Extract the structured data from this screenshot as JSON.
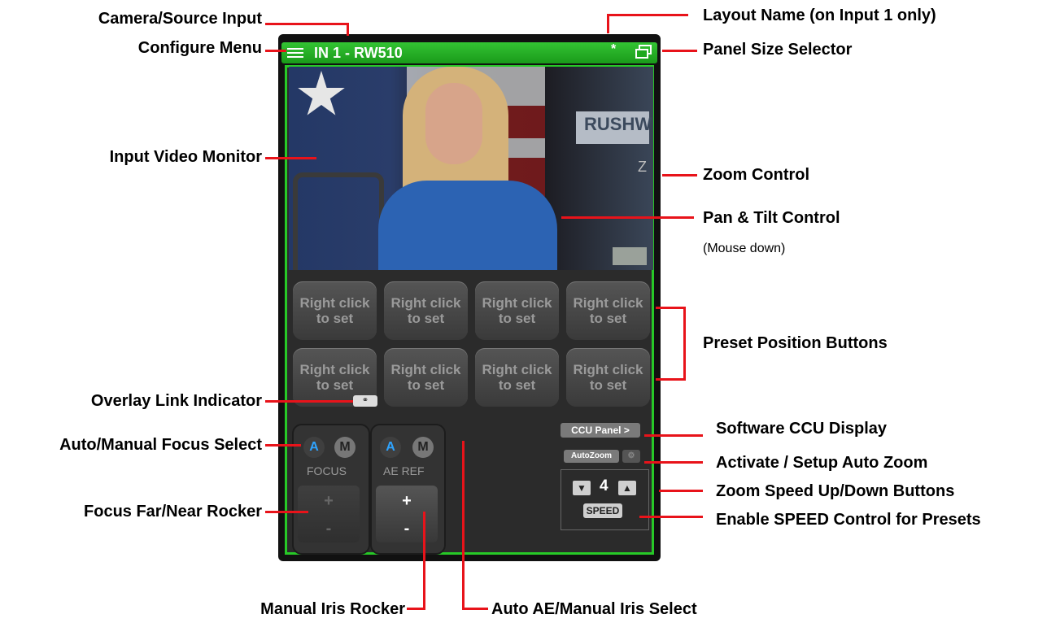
{
  "panel": {
    "title": "IN 1 - RW510",
    "layout_marker": "*",
    "zoom_hint": "Z",
    "presets": [
      {
        "line1": "Right click",
        "line2": "to set"
      },
      {
        "line1": "Right click",
        "line2": "to set"
      },
      {
        "line1": "Right click",
        "line2": "to set"
      },
      {
        "line1": "Right click",
        "line2": "to set"
      },
      {
        "line1": "Right click",
        "line2": "to set"
      },
      {
        "line1": "Right click",
        "line2": "to set"
      },
      {
        "line1": "Right click",
        "line2": "to set"
      },
      {
        "line1": "Right click",
        "line2": "to set"
      }
    ],
    "focus": {
      "auto": "A",
      "manual": "M",
      "label": "FOCUS",
      "plus": "+",
      "minus": "-"
    },
    "aeref": {
      "auto": "A",
      "manual": "M",
      "label": "AE REF",
      "plus": "+",
      "minus": "-"
    },
    "ccu_panel": "CCU Panel >",
    "autozoom": "AutoZoom",
    "speed_value": "4",
    "speed_label": "SPEED",
    "video_sign": "RUSHW"
  },
  "callouts": {
    "camera_source_input": "Camera/Source Input",
    "configure_menu": "Configure Menu",
    "input_video_monitor": "Input Video Monitor",
    "overlay_link_indicator": "Overlay Link Indicator",
    "auto_manual_focus_select": "Auto/Manual Focus Select",
    "focus_far_near_rocker": "Focus Far/Near Rocker",
    "manual_iris_rocker": "Manual Iris Rocker",
    "auto_ae_manual_iris_select": "Auto AE/Manual Iris Select",
    "layout_name": "Layout Name (on Input 1 only)",
    "panel_size_selector": "Panel Size Selector",
    "zoom_control": "Zoom Control",
    "pan_tilt_control": "Pan & Tilt Control",
    "pan_tilt_note": "(Mouse down)",
    "preset_position_buttons": "Preset Position Buttons",
    "software_ccu_display": "Software CCU Display",
    "activate_setup_auto_zoom": "Activate / Setup Auto Zoom",
    "zoom_speed_buttons": "Zoom Speed Up/Down Buttons",
    "enable_speed_control": "Enable SPEED Control for Presets"
  },
  "colors": {
    "accent_green": "#27c927",
    "callout_red": "#e8131a",
    "auto_blue": "#2fa4ff"
  }
}
